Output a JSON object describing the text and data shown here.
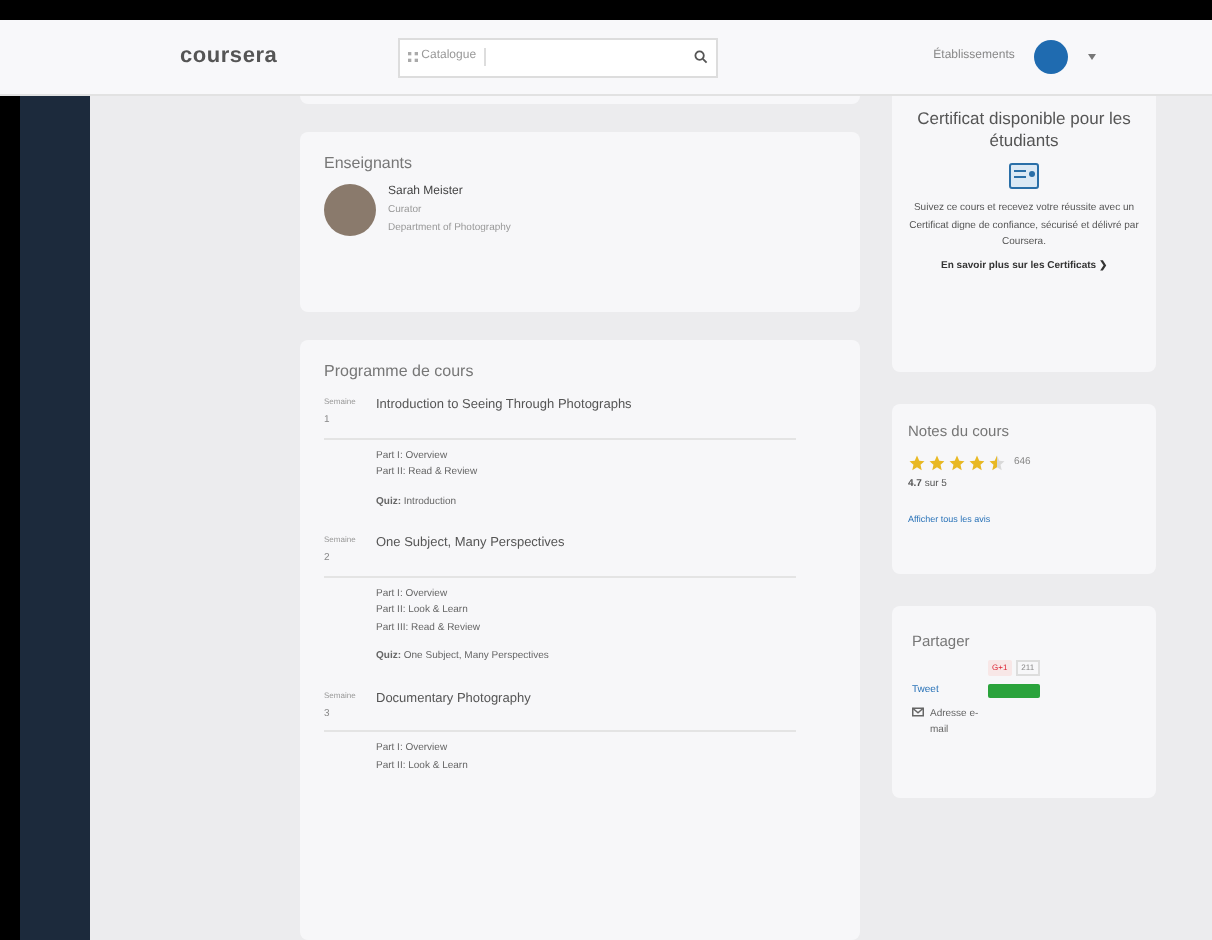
{
  "header": {
    "logo": "coursera",
    "catalog_button": "Catalogue",
    "institutions_link": "Établissements"
  },
  "instructors": {
    "title": "Enseignants",
    "people": [
      {
        "name": "Sarah Meister",
        "role": "Curator",
        "department": "Department of Photography"
      }
    ]
  },
  "syllabus": {
    "title": "Programme de cours",
    "weeks": [
      {
        "label": "Semaine",
        "number": "1",
        "title": "Introduction to Seeing Through Photographs",
        "parts": [
          "Part I: Overview",
          "Part II: Read & Review"
        ],
        "quiz": "**Quiz:** Introduction"
      },
      {
        "label": "Semaine",
        "number": "2",
        "title": "One Subject, Many Perspectives",
        "parts": [
          "Part I: Overview",
          "Part II: Look & Learn",
          "Part III: Read & Review"
        ],
        "quiz": "**Quiz:** One Subject, Many Perspectives"
      },
      {
        "label": "Semaine",
        "number": "3",
        "title": "Documentary Photography",
        "parts": [
          "Part I: Overview",
          "Part II: Look & Learn"
        ]
      }
    ]
  },
  "certificate": {
    "title": "Certificat disponible pour les étudiants",
    "text": "Suivez ce cours et recevez votre réussite avec un Certificat digne de confiance, sécurisé et délivré par Coursera.",
    "link": "En savoir plus sur les Certificats ❯"
  },
  "ratings": {
    "title": "Notes du cours",
    "stars": 4.5,
    "count": "646",
    "score": "**4.7** sur 5",
    "link": "Afficher tous les avis"
  },
  "share": {
    "title": "Partager",
    "gplus": "G+1",
    "gplus_count": "211",
    "tweet": "Tweet",
    "email": "Adresse e-mail"
  }
}
